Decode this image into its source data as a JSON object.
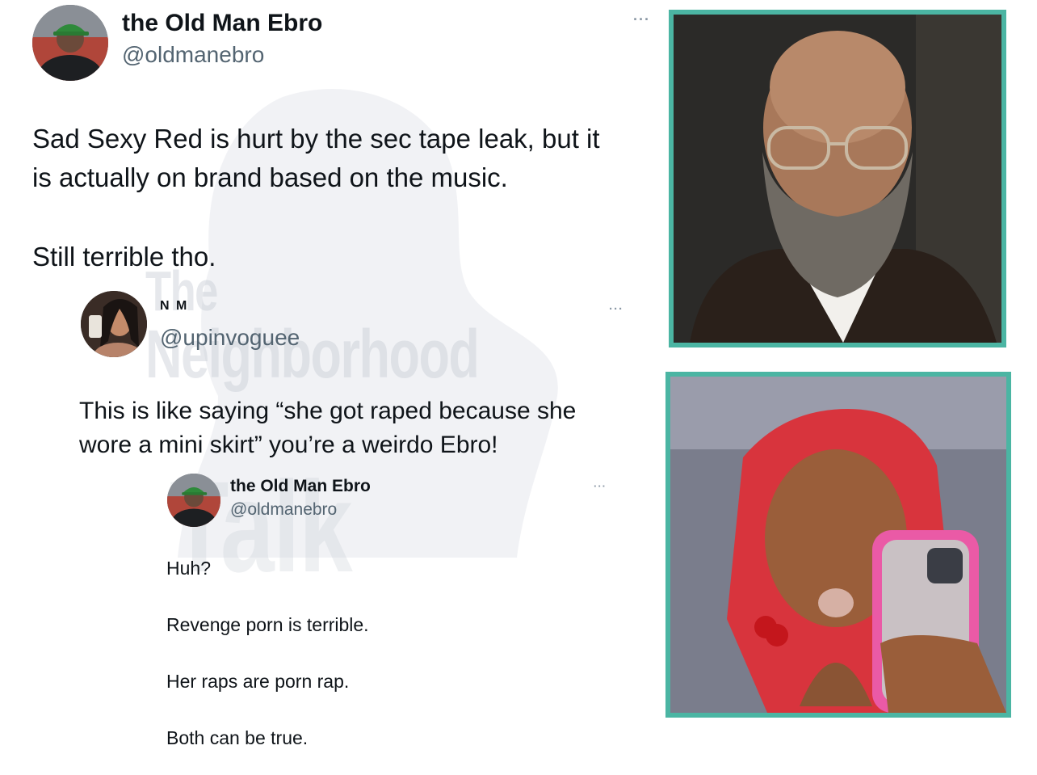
{
  "watermark": {
    "line1": "The",
    "line2": "Neighborhood",
    "line3": "Talk"
  },
  "tweet_main": {
    "display_name": "the Old Man Ebro",
    "handle": "@oldmanebro",
    "more_label": "···",
    "text_line1": "Sad Sexy Red is hurt by the sec tape leak, but it",
    "text_line2": "is actually on brand based on the music.",
    "text_line3": "Still terrible tho."
  },
  "reply_1": {
    "display_name": "N M",
    "handle": "@upinvoguee",
    "more_label": "···",
    "text_line1": "This is like saying “she got raped because she",
    "text_line2": "wore a mini skirt” you’re a weirdo Ebro!"
  },
  "reply_2": {
    "display_name": "the Old Man Ebro",
    "handle": "@oldmanebro",
    "more_label": "···",
    "lines": [
      "Huh?",
      "Revenge porn is terrible.",
      "Her raps are porn rap.",
      "Both can be true."
    ]
  },
  "colors": {
    "frame": "#4bb5a3",
    "handle": "#536471",
    "text": "#0f1419"
  },
  "icons": {
    "avatar_ebro": "man-green-cap-avatar-icon",
    "avatar_nm": "woman-selfie-avatar-icon",
    "more": "more-dots-icon"
  }
}
